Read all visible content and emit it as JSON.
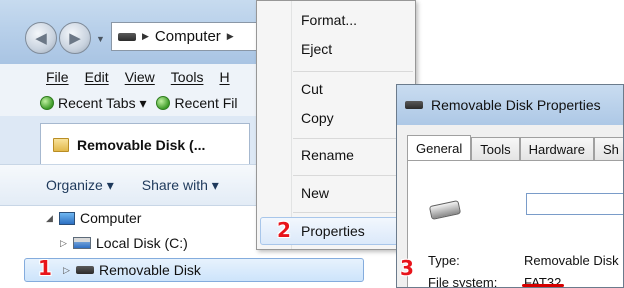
{
  "explorer": {
    "address": {
      "crumbs": [
        "Computer"
      ]
    },
    "menu": [
      "File",
      "Edit",
      "View",
      "Tools",
      "H"
    ],
    "favorites": [
      "Recent Tabs ▾",
      "Recent Fil"
    ],
    "tab": {
      "label": "Removable Disk (..."
    },
    "toolbar": {
      "organize": "Organize ▾",
      "share": "Share with ▾"
    },
    "tree": {
      "computer": "Computer",
      "local_disk": "Local Disk (C:)",
      "removable_disk": "Removable Disk"
    }
  },
  "context_menu": {
    "items": [
      "Format...",
      "Eject",
      "Cut",
      "Copy",
      "Rename",
      "New",
      "Properties"
    ],
    "highlighted": "Properties"
  },
  "properties_dialog": {
    "title": "Removable Disk Properties",
    "tabs": [
      "General",
      "Tools",
      "Hardware",
      "Sh"
    ],
    "active_tab": "General",
    "rows": [
      {
        "label": "Type:",
        "value": "Removable Disk"
      },
      {
        "label": "File system:",
        "value": "FAT32"
      }
    ]
  },
  "steps": [
    "1",
    "2",
    "3"
  ],
  "colors": {
    "step_marker": "#e8141b",
    "highlight": "#cde4fb",
    "titlebar": "#b8d0ea"
  }
}
